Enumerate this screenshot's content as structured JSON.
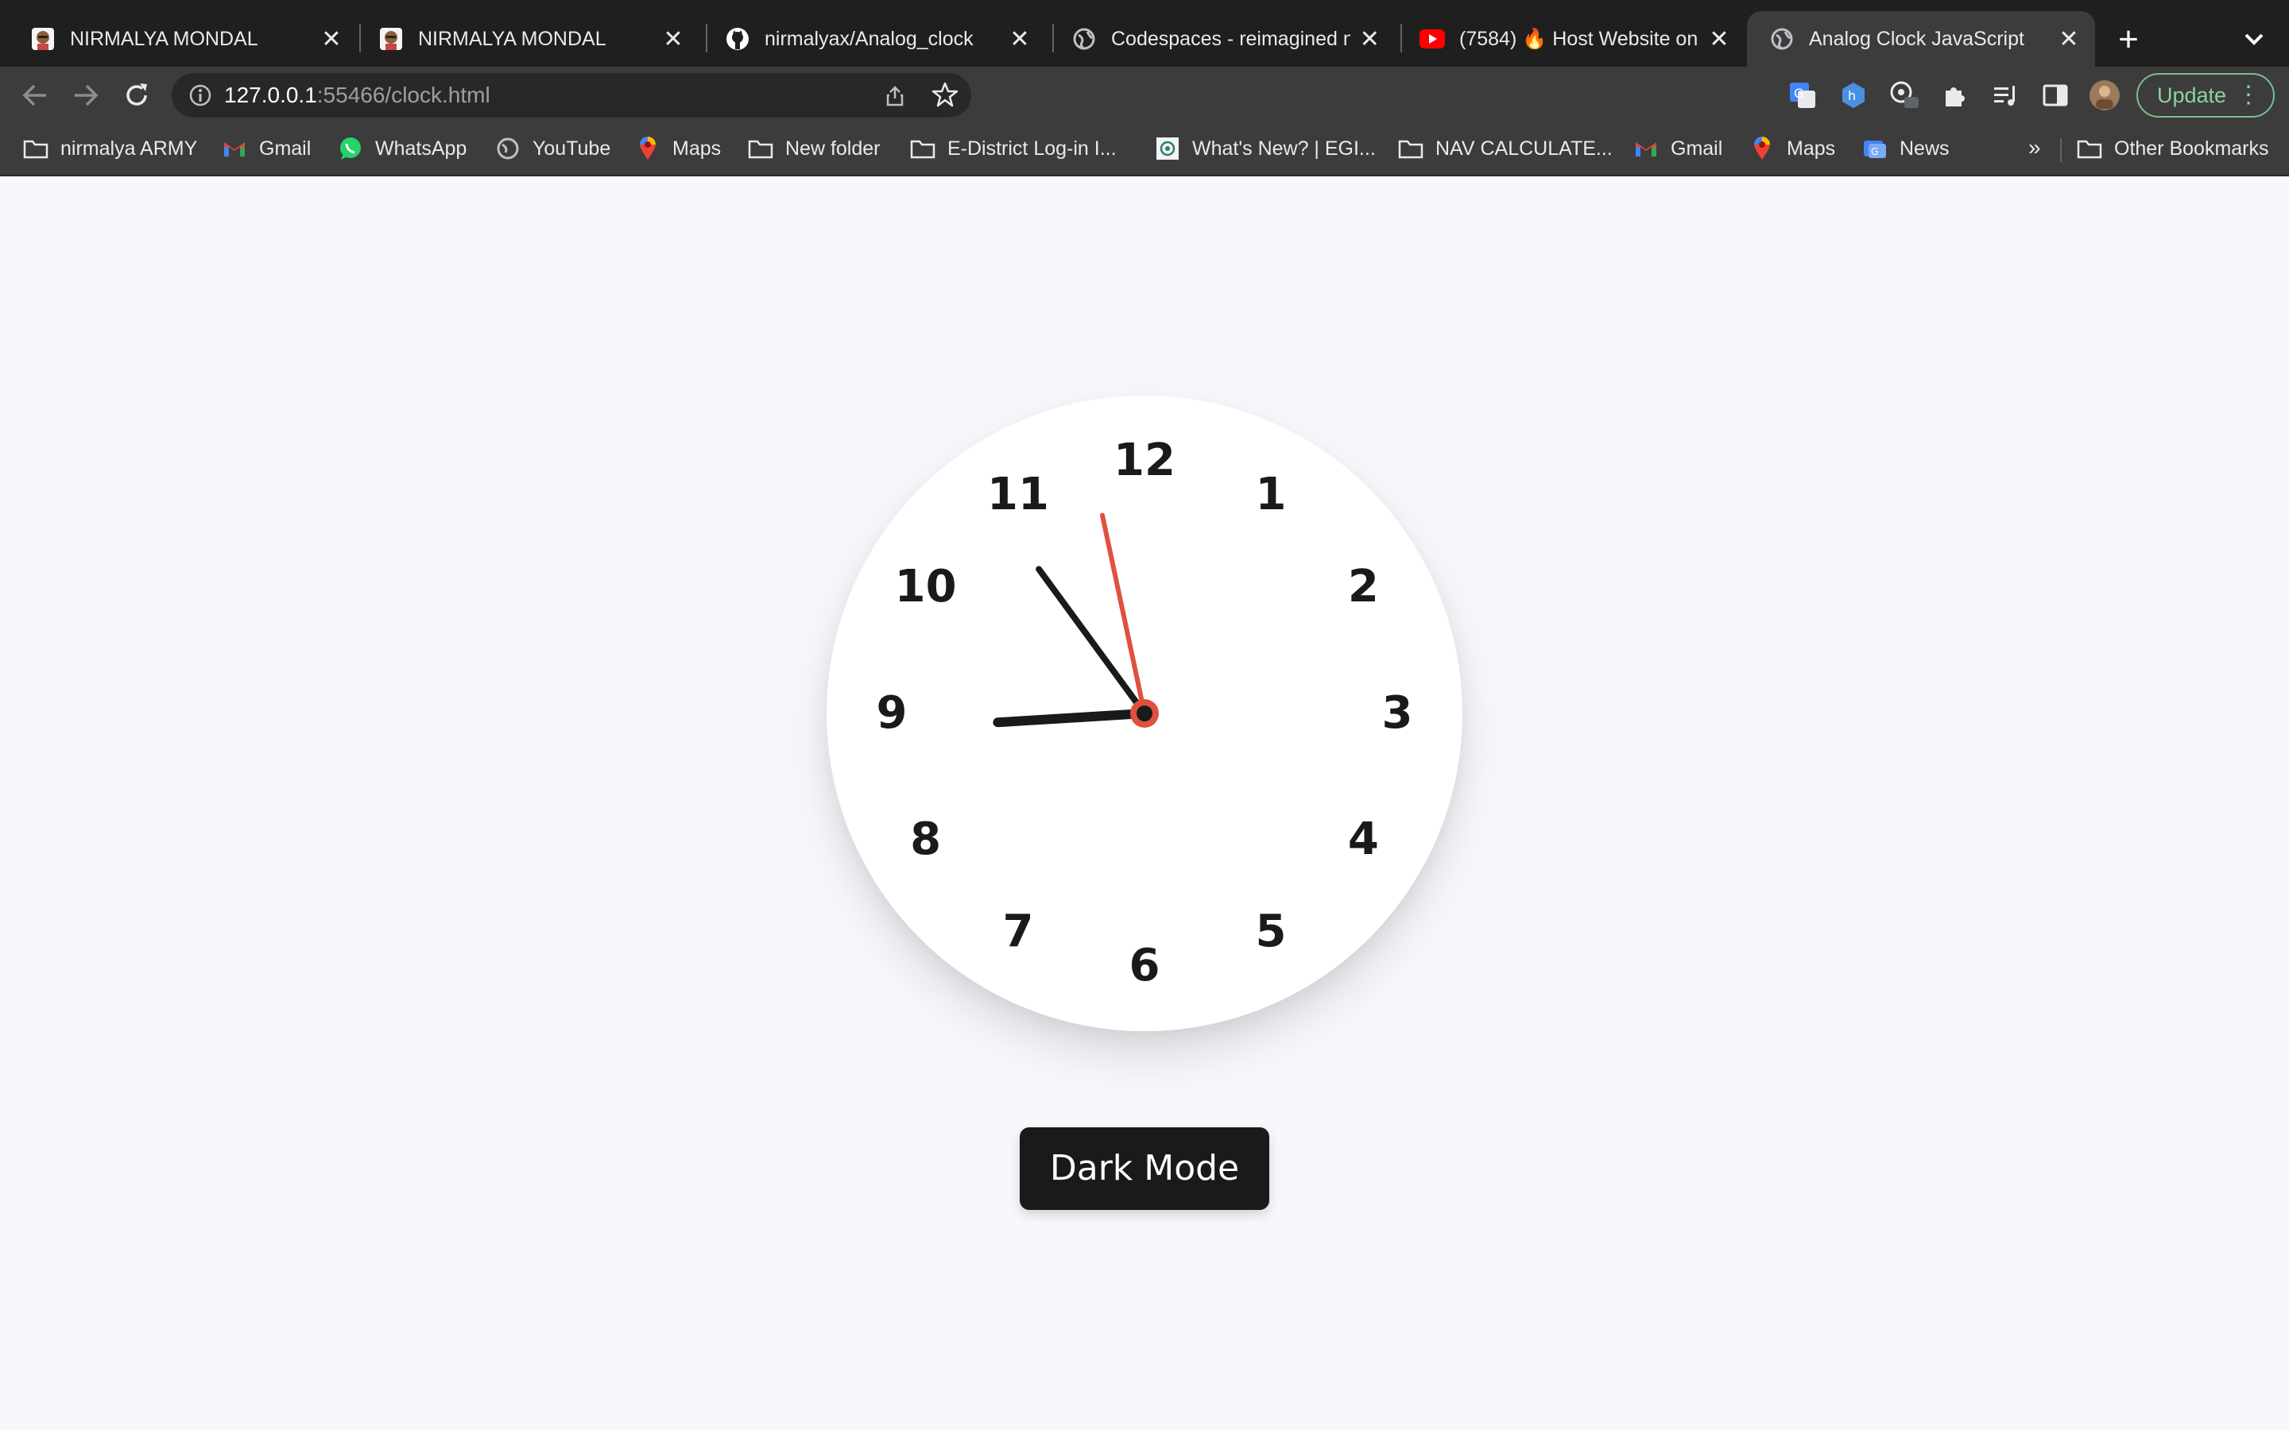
{
  "browser": {
    "tabs": [
      {
        "title": "NIRMALYA MONDAL",
        "icon": "avatar-favicon-icon",
        "active": false
      },
      {
        "title": "NIRMALYA MONDAL",
        "icon": "avatar-favicon-icon",
        "active": false
      },
      {
        "title": "nirmalyax/Analog_clock",
        "icon": "github-icon",
        "active": false
      },
      {
        "title": "Codespaces - reimagined n",
        "icon": "globe-icon",
        "active": false
      },
      {
        "title": "(7584) 🔥 Host Website on",
        "icon": "youtube-icon",
        "active": false
      },
      {
        "title": "Analog Clock JavaScript",
        "icon": "globe-icon",
        "active": true
      }
    ],
    "close_glyph": "✕",
    "new_tab_glyph": "+",
    "address": {
      "host": "127.0.0.1",
      "rest": ":55466/clock.html"
    },
    "update_label": "Update",
    "menu_glyph": "⋮",
    "bookmarks": [
      {
        "label": "nirmalya ARMY",
        "icon": "folder-icon"
      },
      {
        "label": "Gmail",
        "icon": "gmail-icon"
      },
      {
        "label": "WhatsApp",
        "icon": "whatsapp-icon"
      },
      {
        "label": "YouTube",
        "icon": "globe-icon"
      },
      {
        "label": "Maps",
        "icon": "maps-icon"
      },
      {
        "label": "New folder",
        "icon": "folder-icon"
      },
      {
        "label": "E-District  Log-in I...",
        "icon": "folder-icon"
      },
      {
        "label": "What's New? | EGI...",
        "icon": "page-icon"
      },
      {
        "label": "NAV CALCULATE...",
        "icon": "folder-icon"
      },
      {
        "label": "Gmail",
        "icon": "gmail-icon"
      },
      {
        "label": "Maps",
        "icon": "maps-icon"
      },
      {
        "label": "News",
        "icon": "news-icon"
      }
    ],
    "bookmarks_overflow": "»",
    "other_bookmarks_label": "Other Bookmarks"
  },
  "clock": {
    "numbers": [
      "12",
      "1",
      "2",
      "3",
      "4",
      "5",
      "6",
      "7",
      "8",
      "9",
      "10",
      "11"
    ],
    "time": {
      "hour": 8,
      "minute": 53,
      "second": 58
    },
    "colors": {
      "face": "#ffffff",
      "hands": "#1a1a1a",
      "second_hand": "#e0503e"
    }
  },
  "mode_button_label": "Dark Mode",
  "colors": {
    "page_bg": "#f7f8fc",
    "button_bg": "#1a1a1a",
    "update_green": "#8ed1a1"
  }
}
